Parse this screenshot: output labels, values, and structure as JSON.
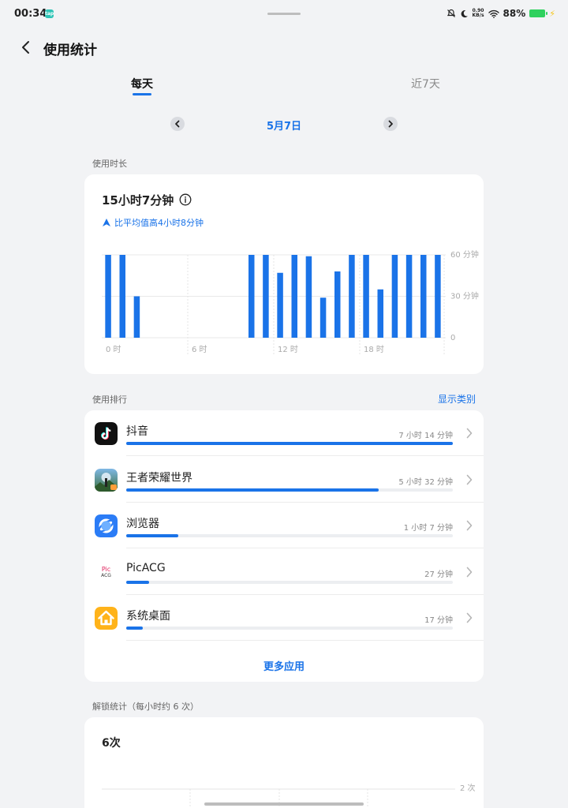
{
  "status_bar": {
    "time": "00:34",
    "app_badge": "tap",
    "net_speed_top": "0.90",
    "net_speed_bottom": "KB/s",
    "battery_percent": "88%",
    "battery_level": 0.88
  },
  "header": {
    "title": "使用统计"
  },
  "tabs": [
    {
      "label": "每天",
      "active": true
    },
    {
      "label": "近7天",
      "active": false
    }
  ],
  "date_nav": {
    "label": "5月7日"
  },
  "usage_duration": {
    "section_title": "使用时长",
    "total": "15小时7分钟",
    "comparison": "比平均值高4小时8分钟"
  },
  "chart_data": {
    "type": "bar",
    "x_tick_labels": [
      "0 时",
      "6 时",
      "12 时",
      "18 时"
    ],
    "y_tick_labels": [
      "60 分钟",
      "30 分钟",
      "0"
    ],
    "ylim": [
      0,
      60
    ],
    "values": [
      60,
      60,
      30,
      0,
      0,
      0,
      0,
      0,
      0,
      0,
      60,
      60,
      47,
      60,
      59,
      29,
      48,
      60,
      60,
      35,
      60,
      60,
      60,
      60
    ],
    "grid": true,
    "color": "#1a73e8"
  },
  "ranking": {
    "section_title": "使用排行",
    "show_category_label": "显示类别",
    "items": [
      {
        "name": "抖音",
        "time": "7 小时 14 分钟",
        "fraction": 1.0,
        "icon": "douyin-icon"
      },
      {
        "name": "王者荣耀世界",
        "time": "5 小时 32 分钟",
        "fraction": 0.772,
        "icon": "game-icon"
      },
      {
        "name": "浏览器",
        "time": "1 小时 7 分钟",
        "fraction": 0.159,
        "icon": "browser-icon"
      },
      {
        "name": "PicACG",
        "time": "27 分钟",
        "fraction": 0.07,
        "icon": "picacg-icon",
        "icon_text_top": "Pic",
        "icon_text_bottom": "ACG"
      },
      {
        "name": "系统桌面",
        "time": "17 分钟",
        "fraction": 0.05,
        "icon": "home-icon"
      }
    ],
    "more_label": "更多应用"
  },
  "unlock": {
    "section_title": "解锁统计（每小时约 6 次）",
    "total": "6次",
    "y_tick_label": "2 次"
  },
  "colors": {
    "accent": "#1a73e8",
    "background": "#f2f3f5",
    "card": "#ffffff"
  }
}
